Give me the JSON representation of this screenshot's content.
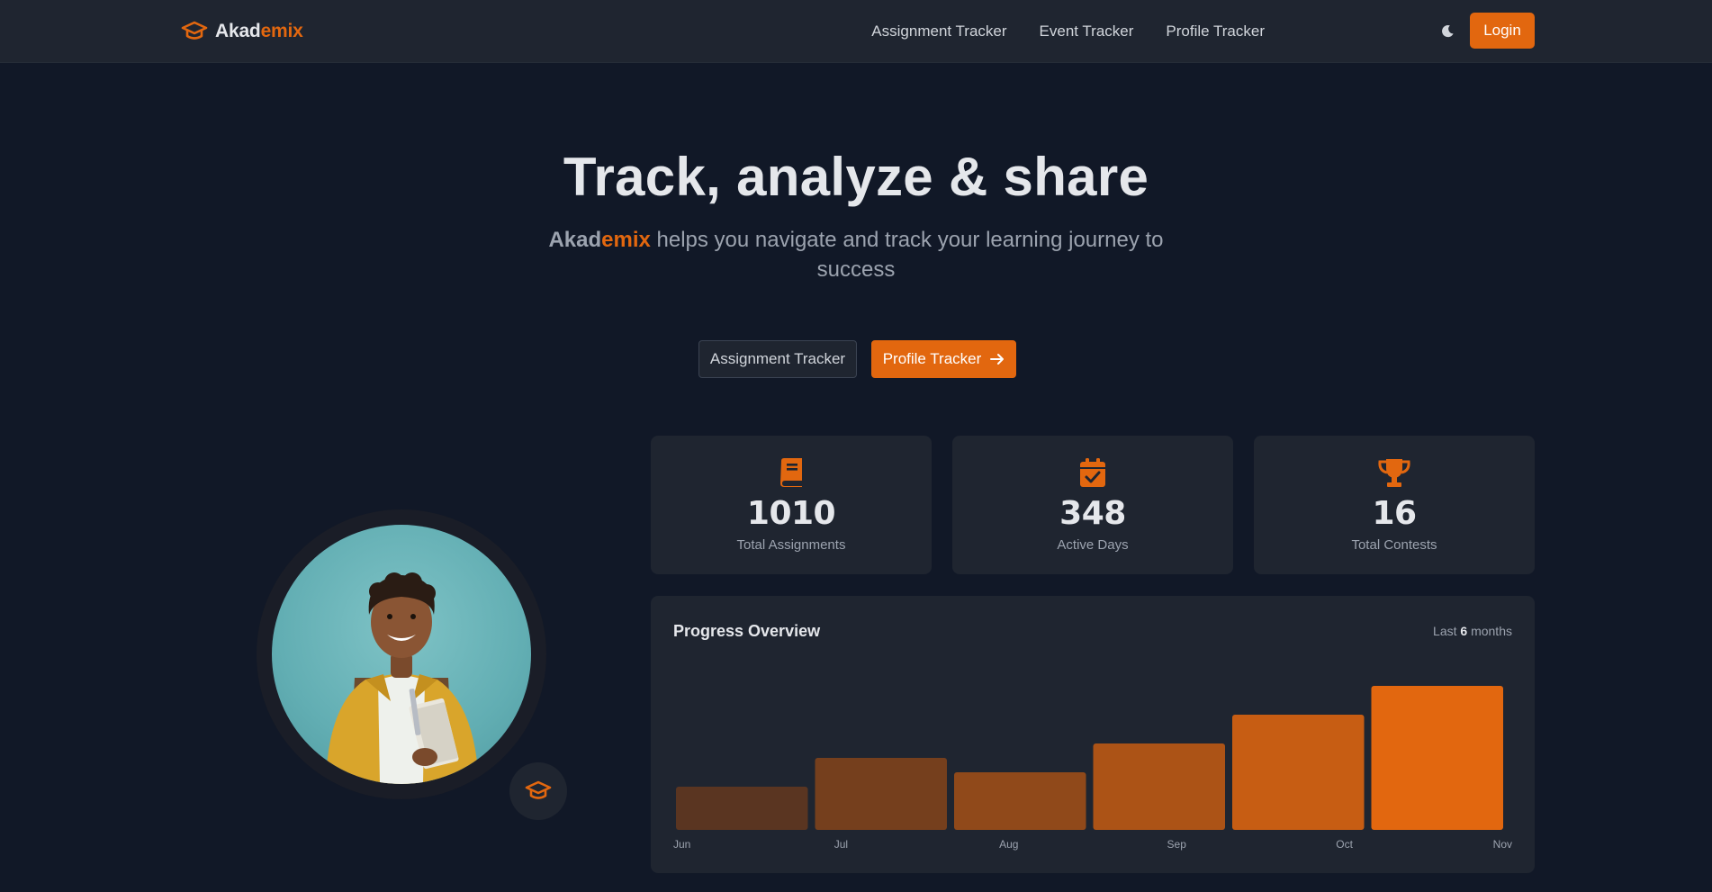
{
  "brand": {
    "part1": "Akad",
    "part2": "emix"
  },
  "nav": {
    "links": [
      "Assignment Tracker",
      "Event Tracker",
      "Profile Tracker"
    ],
    "theme_icon": "moon-icon",
    "login_label": "Login"
  },
  "hero": {
    "title": "Track, analyze & share",
    "subtitle_brand1": "Akad",
    "subtitle_brand2": "emix",
    "subtitle_rest": " helps you navigate and track your learning journey to success",
    "cta_secondary": "Assignment Tracker",
    "cta_primary": "Profile Tracker"
  },
  "stats": [
    {
      "icon": "book-icon",
      "value": "1010",
      "label": "Total Assignments"
    },
    {
      "icon": "calendar-check-icon",
      "value": "348",
      "label": "Active Days"
    },
    {
      "icon": "trophy-icon",
      "value": "16",
      "label": "Total Contests"
    }
  ],
  "progress": {
    "title": "Progress Overview",
    "range_prefix": "Last ",
    "range_value": "6",
    "range_suffix": " months"
  },
  "colors": {
    "accent": "#e2670f",
    "background": "#111827",
    "card": "#1f2530"
  },
  "chart_data": {
    "type": "bar",
    "categories": [
      "Jun",
      "Jul",
      "Aug",
      "Sep",
      "Oct",
      "Nov"
    ],
    "values": [
      30,
      50,
      40,
      60,
      80,
      100
    ],
    "title": "Progress Overview",
    "xlabel": "",
    "ylabel": "",
    "ylim": [
      0,
      100
    ],
    "grid": false
  }
}
